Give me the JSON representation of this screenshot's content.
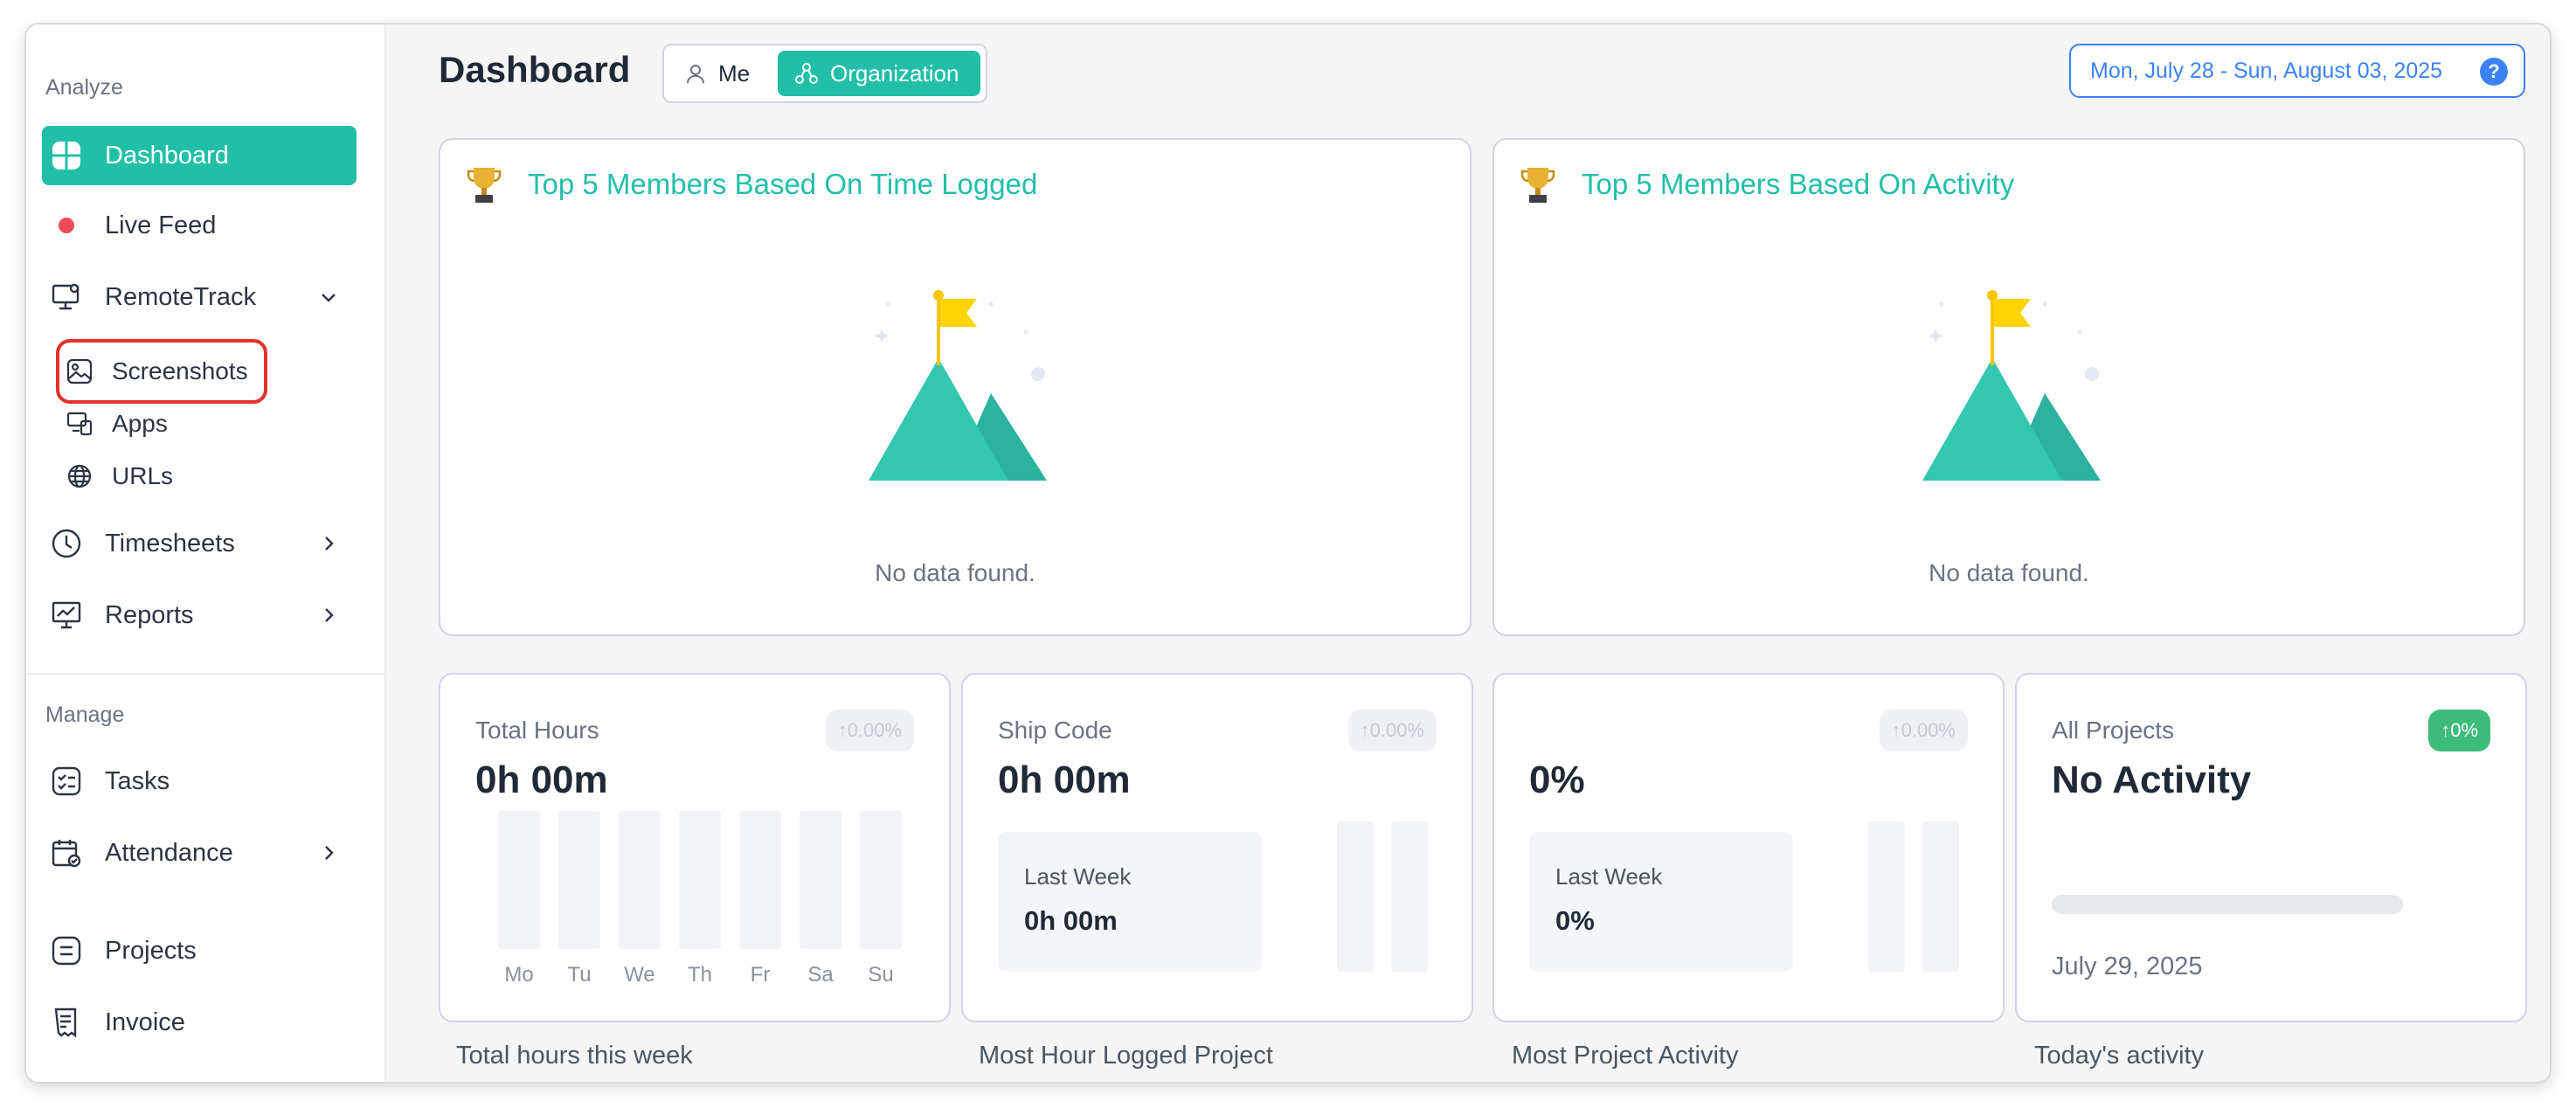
{
  "sidebar": {
    "analyze_label": "Analyze",
    "manage_label": "Manage",
    "items": {
      "dashboard": "Dashboard",
      "live_feed": "Live Feed",
      "remotetrack": "RemoteTrack",
      "screenshots": "Screenshots",
      "apps": "Apps",
      "urls": "URLs",
      "timesheets": "Timesheets",
      "reports": "Reports",
      "tasks": "Tasks",
      "attendance": "Attendance",
      "projects": "Projects",
      "invoice": "Invoice"
    },
    "live_dot_color": "#ef4a5a"
  },
  "header": {
    "title": "Dashboard",
    "toggle_me": "Me",
    "toggle_org": "Organization",
    "date_range": "Mon, July 28 - Sun, August 03, 2025",
    "help": "?"
  },
  "cards": {
    "time_logged": {
      "title": "Top 5 Members Based On Time Logged",
      "empty": "No data found."
    },
    "activity": {
      "title": "Top 5 Members Based On Activity",
      "empty": "No data found."
    }
  },
  "stats": {
    "total_hours": {
      "label": "Total Hours",
      "value": "0h 00m",
      "badge": "↑0.00%",
      "days": [
        "Mo",
        "Tu",
        "We",
        "Th",
        "Fr",
        "Sa",
        "Su"
      ],
      "caption": "Total hours this week"
    },
    "ship_code": {
      "label": "Ship Code",
      "value": "0h 00m",
      "badge": "↑0.00%",
      "last_week_label": "Last Week",
      "last_week_value": "0h 00m",
      "caption": "Most Hour Logged Project"
    },
    "activity": {
      "value": "0%",
      "badge": "↑0.00%",
      "last_week_label": "Last Week",
      "last_week_value": "0%",
      "caption": "Most Project Activity"
    },
    "all_projects": {
      "label": "All Projects",
      "value": "No Activity",
      "badge": "↑0%",
      "date": "July 29, 2025",
      "caption": "Today's activity"
    }
  },
  "colors": {
    "accent": "#21bfa8",
    "date_blue": "#3b82f6",
    "badge_green": "#3dbb7b"
  }
}
